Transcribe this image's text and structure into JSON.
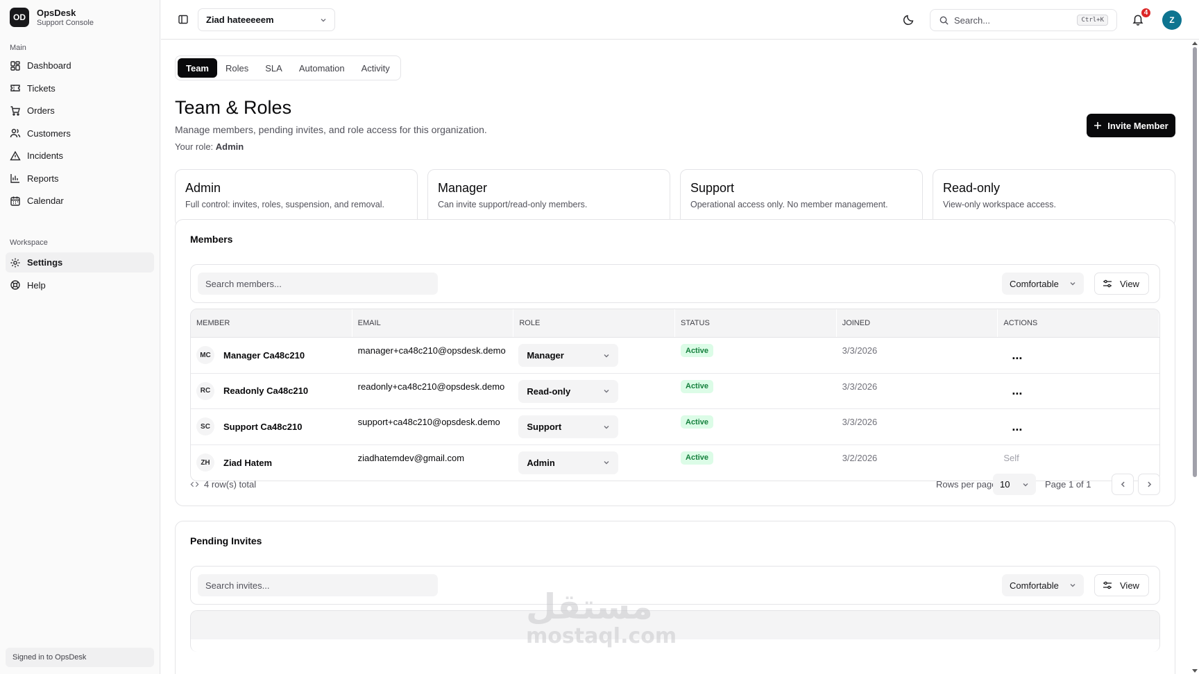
{
  "brand": {
    "logo": "OD",
    "name": "OpsDesk",
    "subtitle": "Support Console"
  },
  "sidebar": {
    "main_label": "Main",
    "main_items": [
      {
        "label": "Dashboard",
        "icon": "dashboard-icon"
      },
      {
        "label": "Tickets",
        "icon": "ticket-icon"
      },
      {
        "label": "Orders",
        "icon": "cart-icon"
      },
      {
        "label": "Customers",
        "icon": "users-icon"
      },
      {
        "label": "Incidents",
        "icon": "alert-triangle-icon"
      },
      {
        "label": "Reports",
        "icon": "bar-chart-icon"
      },
      {
        "label": "Calendar",
        "icon": "calendar-icon"
      }
    ],
    "workspace_label": "Workspace",
    "workspace_items": [
      {
        "label": "Settings",
        "icon": "gear-icon",
        "active": true
      },
      {
        "label": "Help",
        "icon": "lifebuoy-icon"
      }
    ],
    "signed_in": "Signed in to OpsDesk"
  },
  "topbar": {
    "workspace": "Ziad hateeeeem",
    "search_placeholder": "Search...",
    "shortcut": "Ctrl+K",
    "notifications": "4",
    "avatar": "Z"
  },
  "tabs": [
    "Team",
    "Roles",
    "SLA",
    "Automation",
    "Activity"
  ],
  "page": {
    "title": "Team & Roles",
    "description": "Manage members, pending invites, and role access for this organization.",
    "role_label": "Your role:",
    "role_value": "Admin",
    "invite_button": "Invite Member"
  },
  "role_cards": [
    {
      "title": "Admin",
      "desc": "Full control: invites, roles, suspension, and removal."
    },
    {
      "title": "Manager",
      "desc": "Can invite support/read-only members."
    },
    {
      "title": "Support",
      "desc": "Operational access only. No member management."
    },
    {
      "title": "Read-only",
      "desc": "View-only workspace access."
    }
  ],
  "members": {
    "title": "Members",
    "search_placeholder": "Search members...",
    "density": "Comfortable",
    "view": "View",
    "columns": [
      "MEMBER",
      "EMAIL",
      "ROLE",
      "STATUS",
      "JOINED",
      "ACTIONS"
    ],
    "rows": [
      {
        "initials": "MC",
        "name": "Manager Ca48c210",
        "email": "manager+ca48c210@opsdesk.demo",
        "role": "Manager",
        "status": "Active",
        "joined": "3/3/2026",
        "action": "..."
      },
      {
        "initials": "RC",
        "name": "Readonly Ca48c210",
        "email": "readonly+ca48c210@opsdesk.demo",
        "role": "Read-only",
        "status": "Active",
        "joined": "3/3/2026",
        "action": "..."
      },
      {
        "initials": "SC",
        "name": "Support Ca48c210",
        "email": "support+ca48c210@opsdesk.demo",
        "role": "Support",
        "status": "Active",
        "joined": "3/3/2026",
        "action": "..."
      },
      {
        "initials": "ZH",
        "name": "Ziad Hatem",
        "email": "ziadhatemdev@gmail.com",
        "role": "Admin",
        "status": "Active",
        "joined": "3/2/2026",
        "action": "Self"
      }
    ],
    "total": "4 row(s) total",
    "rows_per_page_label": "Rows per page",
    "rows_per_page": "10",
    "page_info": "Page 1 of 1"
  },
  "invites": {
    "title": "Pending Invites",
    "search_placeholder": "Search invites...",
    "density": "Comfortable",
    "view": "View"
  },
  "watermark": {
    "arabic": "مستقل",
    "latin": "mostaql.com"
  }
}
